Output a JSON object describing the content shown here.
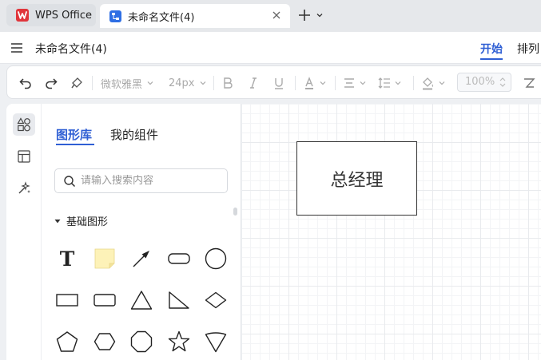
{
  "tabs": {
    "home_label": "WPS Office",
    "doc_label": "未命名文件(4)"
  },
  "menubar": {
    "doc_title": "未命名文件(4)",
    "start": "开始",
    "arrange": "排列"
  },
  "toolbar": {
    "font_family": "微软雅黑",
    "font_size": "24px",
    "zoom": "100%"
  },
  "panel": {
    "tab_library": "图形库",
    "tab_components": "我的组件",
    "search_placeholder": "请输入搜索内容",
    "section_basic": "基础图形",
    "text_tool_glyph": "T"
  },
  "canvas": {
    "node_label": "总经理"
  },
  "colors": {
    "accent": "#2f5fd4",
    "brand_red": "#e0353b",
    "doc_blue": "#2f6fe4",
    "note_yellow": "#fdf2b8"
  }
}
